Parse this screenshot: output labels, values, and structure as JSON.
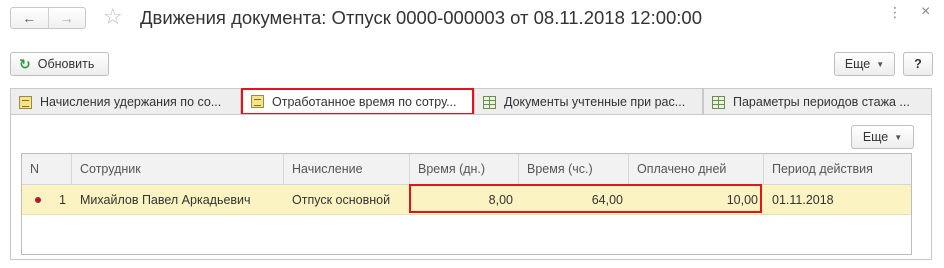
{
  "window": {
    "title": "Движения документа: Отпуск 0000-000003 от 08.11.2018 12:00:00",
    "back_label": "←",
    "forward_label": "→",
    "star_label": "☆",
    "kebab_label": "⋮",
    "close_label": "×"
  },
  "toolbar": {
    "refresh_label": "Обновить",
    "more_label": "Еще",
    "help_label": "?"
  },
  "tabs": [
    {
      "label": "Начисления удержания по со...",
      "icon": "document-icon",
      "active": false
    },
    {
      "label": "Отработанное время по сотру...",
      "icon": "document-icon",
      "active": true
    },
    {
      "label": "Документы учтенные при рас...",
      "icon": "table-icon",
      "active": false
    },
    {
      "label": "Параметры периодов стажа ...",
      "icon": "table-icon",
      "active": false
    }
  ],
  "panel": {
    "more_label": "Еще"
  },
  "table": {
    "columns": [
      "N",
      "Сотрудник",
      "Начисление",
      "Время (дн.)",
      "Время (чс.)",
      "Оплачено дней",
      "Период действия"
    ],
    "rows": [
      {
        "n": "1",
        "employee": "Михайлов Павел Аркадьевич",
        "accrual": "Отпуск основной",
        "time_days": "8,00",
        "time_hours": "64,00",
        "paid_days": "10,00",
        "period": "01.11.2018"
      }
    ]
  },
  "colors": {
    "highlight": "#e0141b",
    "selected_row": "#fcf3c2",
    "row_marker": "#b01a2a",
    "refresh_icon": "#2e9a3d"
  }
}
